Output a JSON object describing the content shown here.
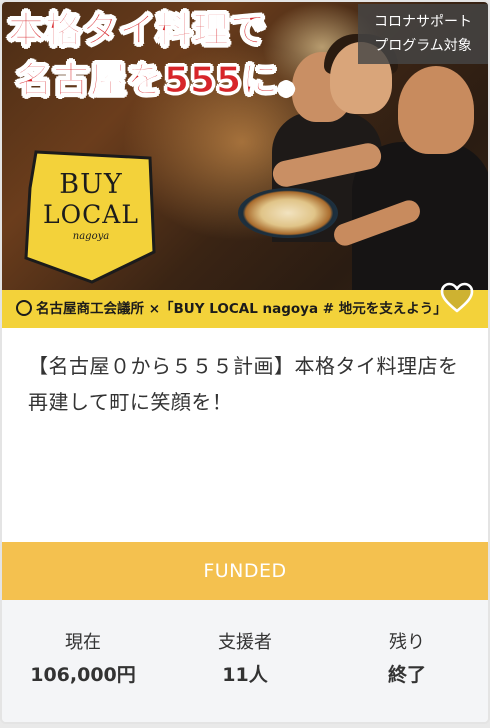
{
  "project": {
    "image": {
      "headline_line1": "本格タイ料理で",
      "headline_line2": "名古屋を555に。",
      "badge_line1": "コロナサポート",
      "badge_line2": "プログラム対象",
      "logo_line1": "BUY",
      "logo_line2": "LOCAL",
      "logo_line3": "nagoya",
      "strip_text": "名古屋商工会議所 ×「BUY LOCAL nagoya # 地元を支えよう」",
      "strip_color": "#f3d23a"
    },
    "favorite_icon": "heart-icon",
    "title": "【名古屋０から５５５計画】本格タイ料理店を再建して町に笑顔を！",
    "status_label": "FUNDED",
    "status_color": "#f4c14f",
    "stats": [
      {
        "label": "現在",
        "value": "106,000円"
      },
      {
        "label": "支援者",
        "value": "11人"
      },
      {
        "label": "残り",
        "value": "終了"
      }
    ]
  }
}
